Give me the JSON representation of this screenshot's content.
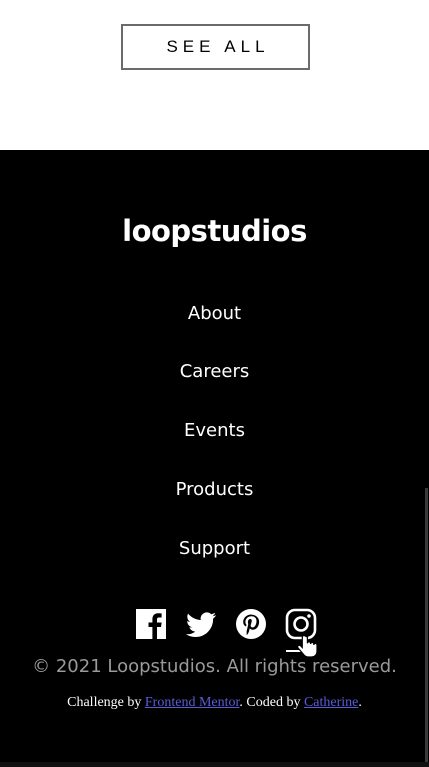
{
  "top": {
    "see_all_label": "See all"
  },
  "footer": {
    "logo": "loopstudios",
    "nav": [
      {
        "label": "About"
      },
      {
        "label": "Careers"
      },
      {
        "label": "Events"
      },
      {
        "label": "Products"
      },
      {
        "label": "Support"
      }
    ],
    "socials": [
      {
        "icon": "facebook-icon"
      },
      {
        "icon": "twitter-icon"
      },
      {
        "icon": "pinterest-icon"
      },
      {
        "icon": "instagram-icon"
      }
    ],
    "copyright": "© 2021 Loopstudios. All rights reserved.",
    "attribution": {
      "prefix": "Challenge by ",
      "link1": "Frontend Mentor",
      "middle": ". Coded by ",
      "link2": "Catherine",
      "suffix": "."
    }
  },
  "colors": {
    "footer_bg": "#000000",
    "text": "#ffffff",
    "copyright_text": "#9a9a9a",
    "link": "#5b5bd9",
    "button_border": "#6b6b6b"
  }
}
